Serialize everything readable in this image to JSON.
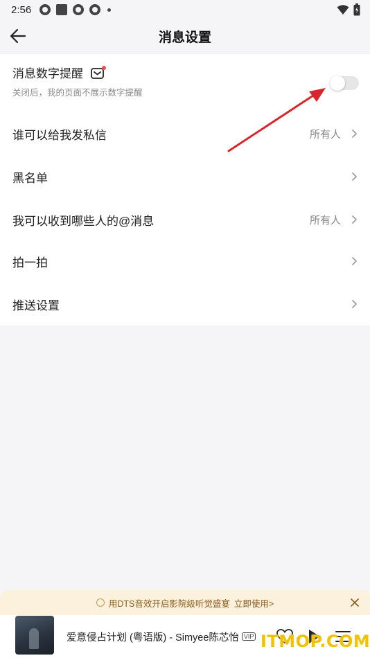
{
  "status_bar": {
    "time": "2:56",
    "icons": [
      "app-icon",
      "square-icon",
      "app-icon",
      "app-icon",
      "dot-icon"
    ],
    "right_icons": [
      "wifi-icon",
      "battery-icon"
    ]
  },
  "header": {
    "title": "消息设置",
    "back_icon": "back-arrow-icon"
  },
  "settings": {
    "badge_row": {
      "label": "消息数字提醒",
      "subtitle": "关闭后，我的页面不展示数字提醒",
      "icon": "message-badge-icon",
      "toggle_on": false
    },
    "rows": [
      {
        "label": "谁可以给我发私信",
        "value": "所有人"
      },
      {
        "label": "黑名单",
        "value": ""
      },
      {
        "label": "我可以收到哪些人的@消息",
        "value": "所有人"
      },
      {
        "label": "拍一拍",
        "value": ""
      },
      {
        "label": "推送设置",
        "value": ""
      }
    ]
  },
  "promo_banner": {
    "text": "用DTS音效开启影院级听觉盛宴",
    "action": "立即使用>"
  },
  "mini_player": {
    "song": "爱意侵占计划 (粤语版) - Simyee陈芯怡",
    "badge": "VIP",
    "controls": [
      "heart-icon",
      "play-icon",
      "playlist-icon"
    ]
  },
  "watermark": "ITMOP.COM",
  "colors": {
    "background": "#f5f5f7",
    "card": "#ffffff",
    "annotation_arrow": "#d8262c",
    "promo_background": "#fbf1dc",
    "watermark": "#f2c200"
  }
}
